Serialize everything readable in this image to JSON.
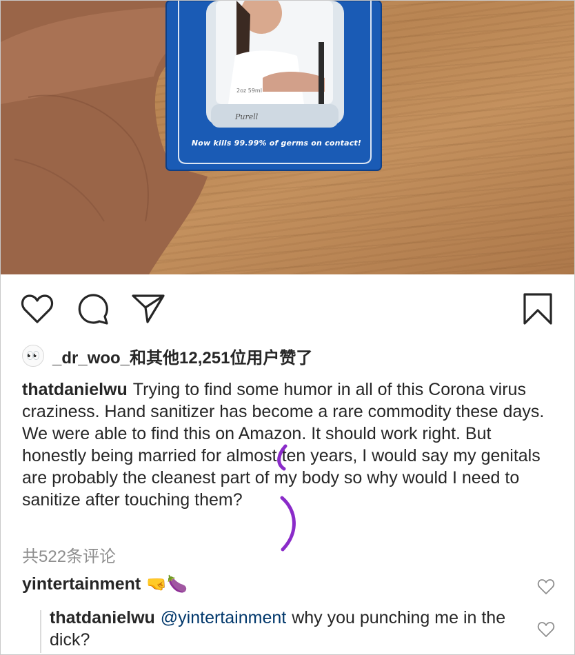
{
  "post": {
    "photo": {
      "package_caption": "Now kills 99.99% of germs on contact!",
      "bottle_label": "2oz 59ml"
    },
    "likes": {
      "avatar_glyph": "👀",
      "text": "_dr_woo_和其他12,251位用户赞了"
    },
    "caption": {
      "username": "thatdanielwu",
      "text": "Trying to find some humor in all of this Corona virus craziness. Hand sanitizer has become a rare commodity these days. We were able to find this on Amazon. It should work right. But honestly being married for almost ten years, I would say my genitals are probably the cleanest part of my body so why would I need to sanitize after touching them?"
    },
    "comments_count_text": "共522条评论",
    "comments": [
      {
        "username": "yintertainment",
        "emojis": "🤜🍆"
      }
    ],
    "reply": {
      "username": "thatdanielwu",
      "mention": "@yintertainment",
      "text": "why you punching me in the dick?"
    }
  },
  "icons": {
    "like": "heart-icon",
    "comment": "comment-bubble-icon",
    "share": "paper-plane-icon",
    "save": "bookmark-icon",
    "comment_like": "small-heart-icon"
  },
  "colors": {
    "annotation": "#8a2bc9",
    "mention": "#00376b",
    "muted": "#8e8e8e",
    "package_blue": "#1a5bb5"
  }
}
